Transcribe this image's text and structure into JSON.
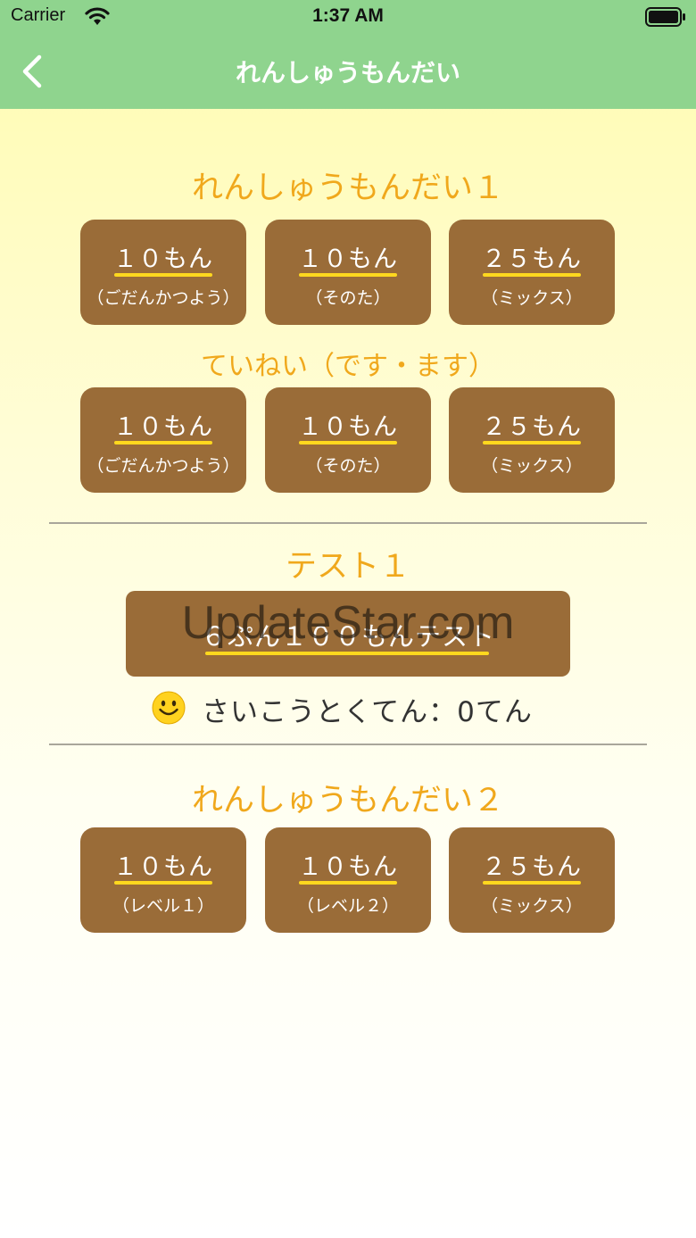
{
  "status_bar": {
    "carrier": "Carrier",
    "time": "1:37 AM"
  },
  "nav": {
    "title": "れんしゅうもんだい"
  },
  "practice1": {
    "title": "れんしゅうもんだい１",
    "buttons": [
      {
        "main": "１０もん",
        "sub": "（ごだんかつよう）"
      },
      {
        "main": "１０もん",
        "sub": "（そのた）"
      },
      {
        "main": "２５もん",
        "sub": "（ミックス）"
      }
    ]
  },
  "polite": {
    "title": "ていねい（です・ます）",
    "buttons": [
      {
        "main": "１０もん",
        "sub": "（ごだんかつよう）"
      },
      {
        "main": "１０もん",
        "sub": "（そのた）"
      },
      {
        "main": "２５もん",
        "sub": "（ミックス）"
      }
    ]
  },
  "test1": {
    "title": "テスト１",
    "button": "６ぷん１００もんテスト",
    "best_score": "さいこうとくてん：0てん"
  },
  "watermark": "UpdateStar.com",
  "practice2": {
    "title": "れんしゅうもんだい２",
    "buttons": [
      {
        "main": "１０もん",
        "sub": "（レベル１）"
      },
      {
        "main": "１０もん",
        "sub": "（レベル２）"
      },
      {
        "main": "２５もん",
        "sub": "（ミックス）"
      }
    ]
  },
  "colors": {
    "nav_bar": "#8fd48e",
    "button": "#9a6c38",
    "underline": "#ffd81e",
    "section_title": "#f0a81c"
  },
  "icons": [
    "wifi-icon",
    "battery-icon",
    "back-chevron-icon",
    "smiley-icon"
  ]
}
